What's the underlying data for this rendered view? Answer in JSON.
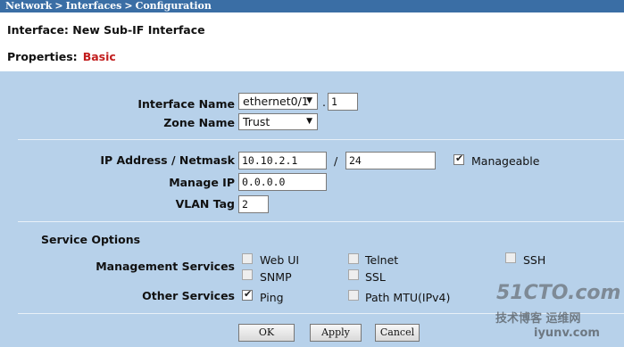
{
  "breadcrumb": {
    "level1": "Network",
    "level2": "Interfaces",
    "level3": "Configuration"
  },
  "header": {
    "title": "Interface: New Sub-IF Interface",
    "properties_label": "Properties:",
    "properties_value": "Basic"
  },
  "form": {
    "interface_name_label": "Interface Name",
    "interface_name_value": "ethernet0/1",
    "subif_dot": ".",
    "subif_value": "1",
    "zone_name_label": "Zone Name",
    "zone_name_value": "Trust",
    "ip_label": "IP Address / Netmask",
    "ip_value": "10.10.2.1",
    "netmask_sep": "/",
    "netmask_value": "24",
    "manageable_label": "Manageable",
    "manage_ip_label": "Manage IP",
    "manage_ip_value": "0.0.0.0",
    "vlan_label": "VLAN Tag",
    "vlan_value": "2"
  },
  "service_options": {
    "title": "Service Options",
    "management_label": "Management Services",
    "other_label": "Other Services",
    "items": {
      "webui": "Web UI",
      "telnet": "Telnet",
      "ssh": "SSH",
      "snmp": "SNMP",
      "ssl": "SSL",
      "ping": "Ping",
      "pathmtu": "Path MTU(IPv4)"
    }
  },
  "buttons": {
    "ok": "OK",
    "apply": "Apply",
    "cancel": "Cancel"
  },
  "watermark": {
    "line1": "51CTO.com",
    "line2": "技术博客",
    "line3": "运维网",
    "line4": "iyunv.com"
  },
  "colors": {
    "breadcrumb_bg": "#3a6ea5",
    "panel_bg": "#b7d1ea",
    "accent_red": "#c21d1d"
  }
}
